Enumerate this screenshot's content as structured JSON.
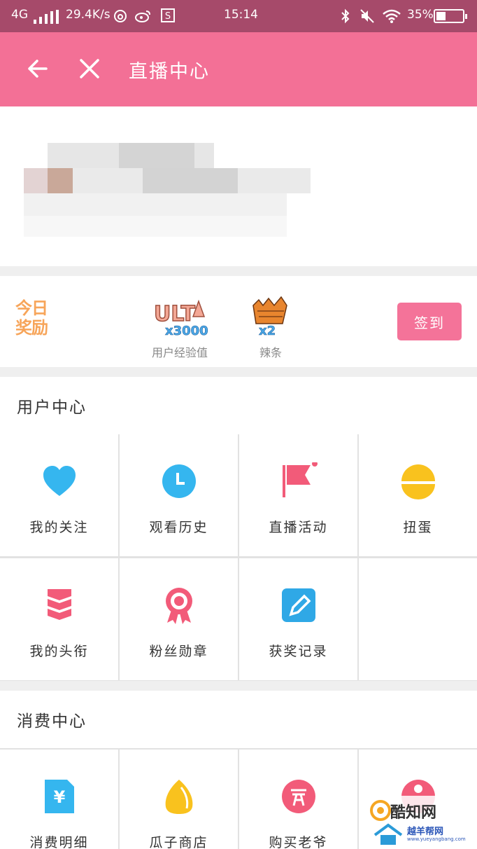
{
  "status_bar": {
    "network": "4G",
    "speed": "29.4K/s",
    "time": "15:14",
    "battery": "35%",
    "battery_level": 0.35,
    "icons": [
      "signal-icon",
      "netease-icon",
      "weibo-icon",
      "s-app-icon",
      "bluetooth-icon",
      "mute-icon",
      "wifi-icon",
      "battery-icon"
    ]
  },
  "app_bar": {
    "title": "直播中心",
    "icons": [
      "back-arrow-icon",
      "close-icon"
    ]
  },
  "rewards": {
    "today_label": "今日奖励",
    "items": [
      {
        "badge": "ULT",
        "amount": "x3000",
        "label": "用户经验值"
      },
      {
        "badge": "",
        "amount": "x2",
        "label": "辣条"
      }
    ],
    "checkin_label": "签到"
  },
  "user_center": {
    "title": "用户中心",
    "items": [
      {
        "label": "我的关注",
        "icon": "heart-icon",
        "color": "#35b6ef"
      },
      {
        "label": "观看历史",
        "icon": "clock-icon",
        "color": "#35b6ef"
      },
      {
        "label": "直播活动",
        "icon": "flag-icon",
        "color": "#f25b79"
      },
      {
        "label": "扭蛋",
        "icon": "gashapon-icon",
        "color": "#f9c21e"
      },
      {
        "label": "我的头衔",
        "icon": "rank-chevrons-icon",
        "color": "#f25b79"
      },
      {
        "label": "粉丝勋章",
        "icon": "medal-icon",
        "color": "#f25b79"
      },
      {
        "label": "获奖记录",
        "icon": "edit-record-icon",
        "color": "#2fa8e6"
      }
    ]
  },
  "consume_center": {
    "title": "消费中心",
    "items": [
      {
        "label": "消费明细",
        "icon": "yen-receipt-icon",
        "color": "#35b6ef"
      },
      {
        "label": "瓜子商店",
        "icon": "melon-seed-icon",
        "color": "#f9c21e"
      },
      {
        "label": "购买老爷",
        "icon": "lord-badge-icon",
        "color": "#f25b79"
      },
      {
        "label": "",
        "icon": "partial-icon",
        "color": "#f25b79"
      }
    ]
  },
  "watermark": {
    "line1": "酷知网",
    "line2": "越羊帮网",
    "url": "www.yueyangbang.com"
  },
  "colors": {
    "status_bar": "#a64a6a",
    "app_bar": "#f37096",
    "accent": "#f47399",
    "reward_orange": "#f7a55a"
  }
}
